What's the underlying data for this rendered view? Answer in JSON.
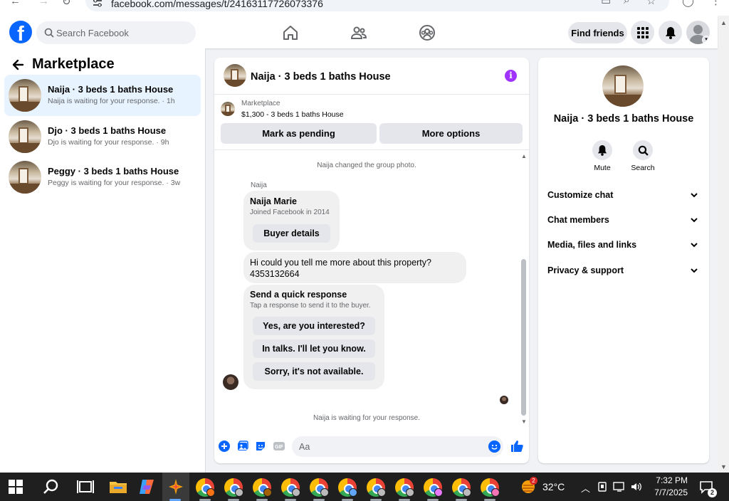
{
  "browser": {
    "url": "facebook.com/messages/t/24163117726073376"
  },
  "header": {
    "search_placeholder": "Search Facebook",
    "find_friends_label": "Find friends",
    "logo_letter": "f"
  },
  "sidebar": {
    "title": "Marketplace",
    "listings": [
      {
        "title": "Naija · 3 beds 1 baths House",
        "subtitle": "Naija is waiting for your response. · 1h",
        "active": true
      },
      {
        "title": "Djo · 3 beds 1 baths House",
        "subtitle": "Djo is waiting for your response. · 9h",
        "active": false
      },
      {
        "title": "Peggy · 3 beds 1 baths House",
        "subtitle": "Peggy is waiting for your response. · 3w",
        "active": false
      }
    ]
  },
  "chat": {
    "title": "Naija · 3 beds 1 baths House",
    "marketplace_label": "Marketplace",
    "listing_summary": "$1,300 - 3 beds 1 baths House",
    "mark_pending_label": "Mark as pending",
    "more_options_label": "More options",
    "system_photo_change": "Naija changed the group photo.",
    "sender_name": "Naija",
    "profile_card": {
      "name": "Naija Marie",
      "joined": "Joined Facebook in 2014",
      "button": "Buyer details"
    },
    "message": {
      "line1": "Hi could you tell me more about this property?",
      "line2": "4353132664"
    },
    "quick_response": {
      "heading": "Send a quick response",
      "subheading": "Tap a response to send it to the buyer.",
      "options": [
        "Yes, are you interested?",
        "In talks. I'll let you know.",
        "Sorry, it's not available."
      ]
    },
    "waiting_notice": "Naija is waiting for your response.",
    "composer_placeholder": "Aa"
  },
  "details": {
    "title": "Naija · 3 beds 1 baths House",
    "mute_label": "Mute",
    "search_label": "Search",
    "sections": [
      "Customize chat",
      "Chat members",
      "Media, files and links",
      "Privacy & support"
    ]
  },
  "taskbar": {
    "weather_badge": "2",
    "temperature": "32°C",
    "time": "7:32 PM",
    "date": "7/7/2025",
    "notification_count": "2"
  },
  "colors": {
    "facebook_blue": "#0866ff",
    "active_listing_bg": "#e7f3ff",
    "info_purple": "#a033ff",
    "page_bg": "#f0f2f5"
  }
}
